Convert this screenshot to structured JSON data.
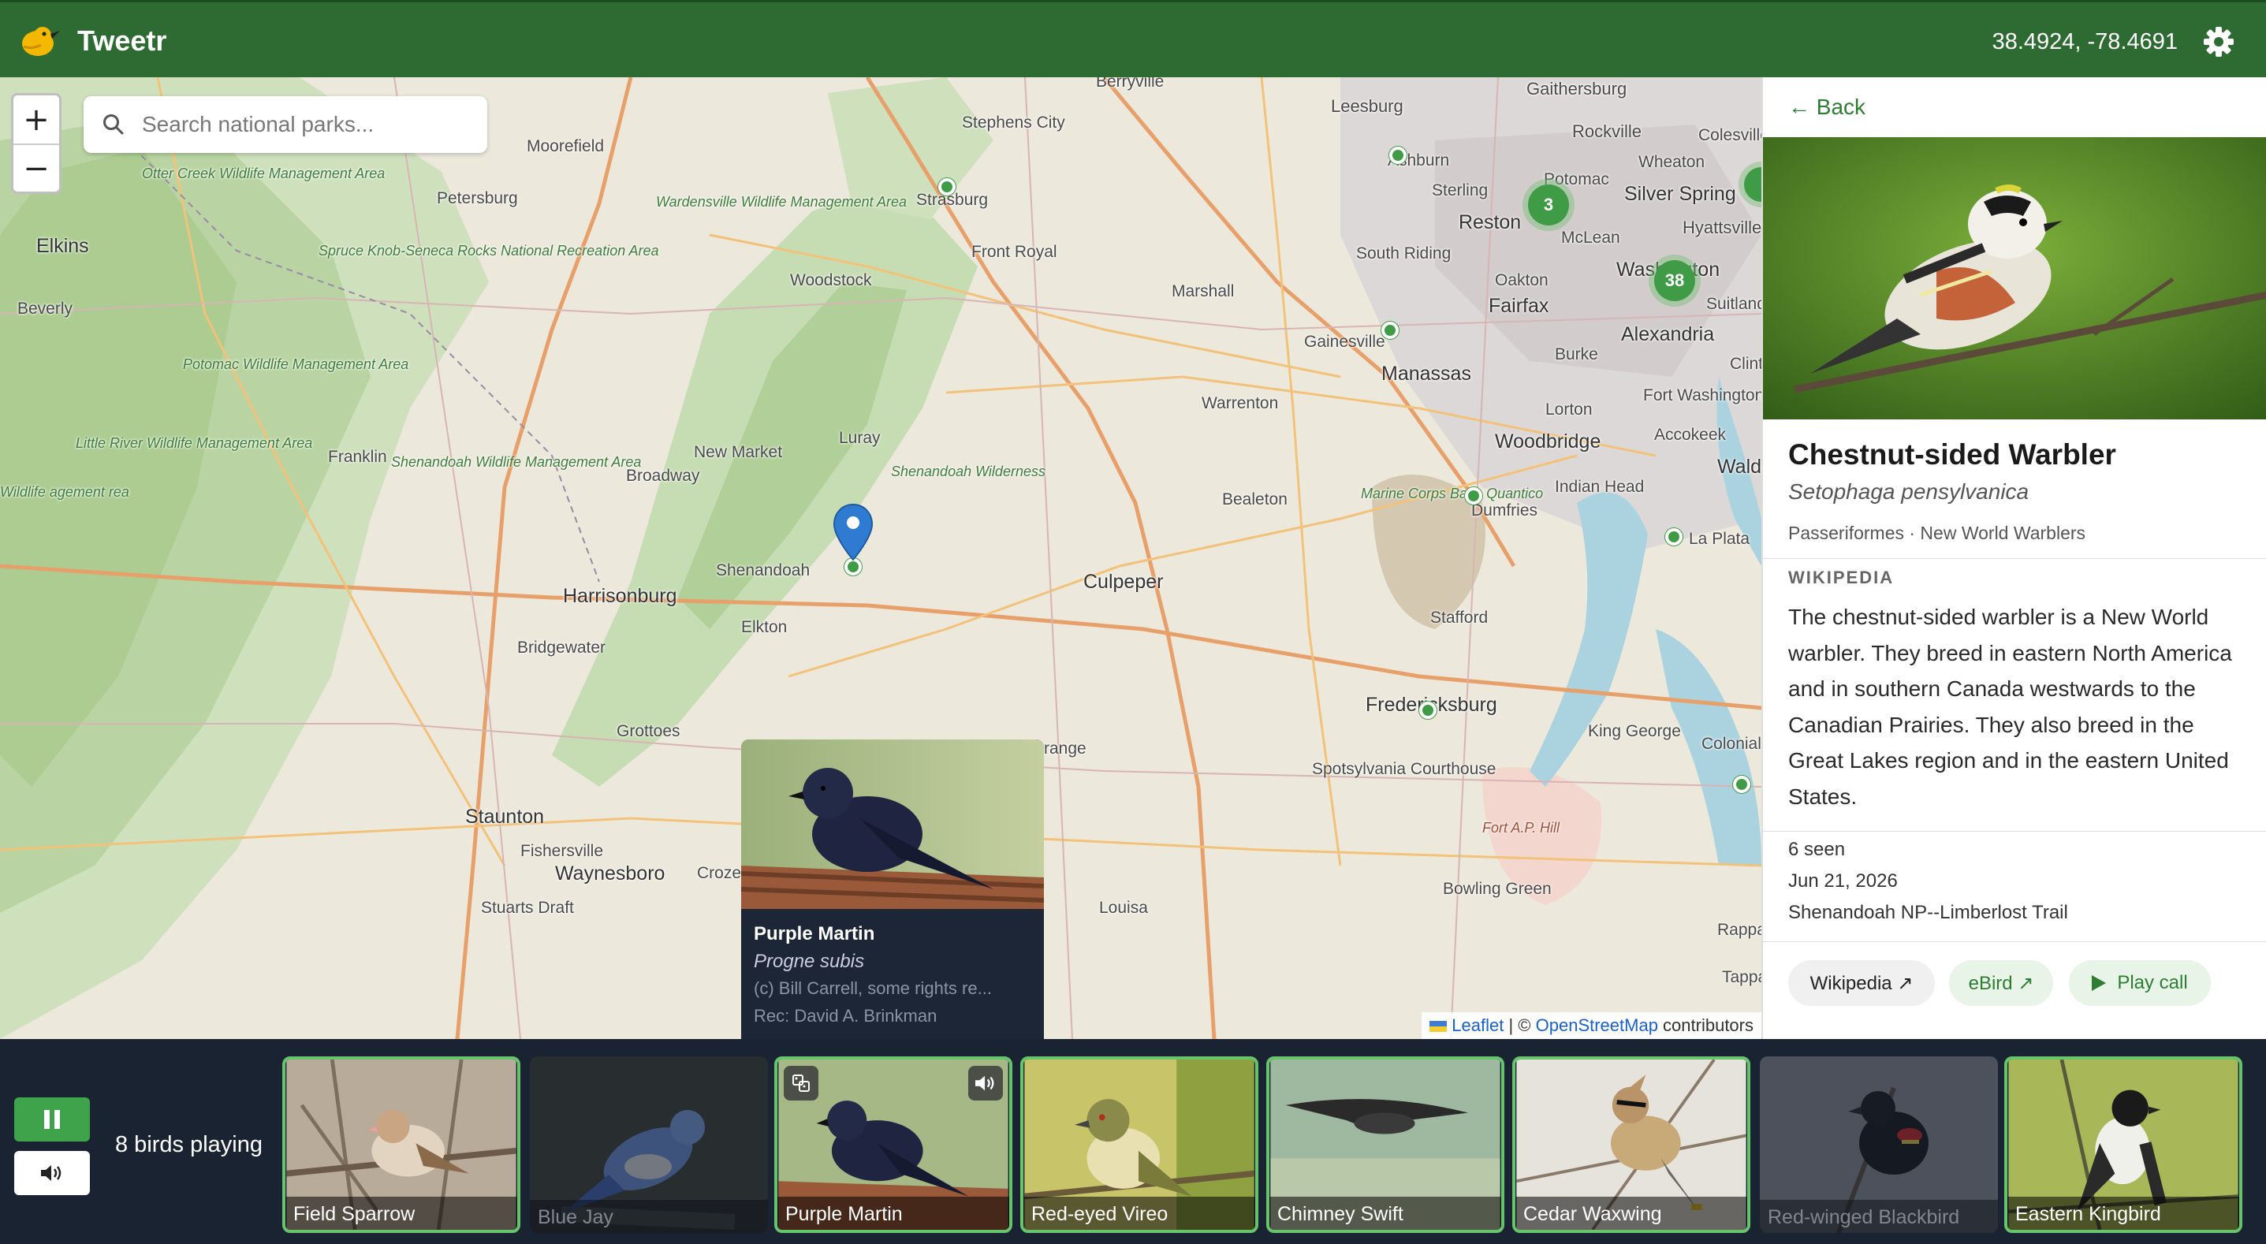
{
  "header": {
    "app_title": "Tweetr",
    "coords": "38.4924, -78.4691",
    "logo_icon": "bird-logo-icon",
    "settings_icon": "gear-icon"
  },
  "map": {
    "zoom_in": "+",
    "zoom_out": "−",
    "search_placeholder": "Search national parks...",
    "labels": {
      "berryville": "Berryville",
      "leesburg": "Leesburg",
      "gaithersburg": "Gaithersburg",
      "rockville": "Rockville",
      "colesville": "Colesville",
      "potomac": "Potomac",
      "wheaton": "Wheaton",
      "ashburn": "Ashburn",
      "stephens_city": "Stephens City",
      "moorefield": "Moorefield",
      "strasburg": "Strasburg",
      "otter_creek": "Otter Creek Wildlife Management Area",
      "petersburg": "Petersburg",
      "wardensville": "Wardensville Wildlife Management Area",
      "sterling": "Sterling",
      "silver_spring": "Silver Spring",
      "reston": "Reston",
      "mclean": "McLean",
      "hyattsville": "Hyattsville",
      "elkins": "Elkins",
      "spruce_knob": "Spruce Knob-Seneca Rocks National Recreation Area",
      "front_royal": "Front Royal",
      "south_riding": "South Riding",
      "woodstock": "Woodstock",
      "oakton": "Oakton",
      "washington": "Washington",
      "suitland": "Suitland",
      "beverly": "Beverly",
      "marshall": "Marshall",
      "fairfax": "Fairfax",
      "gainesville": "Gainesville",
      "burke": "Burke",
      "alexandria": "Alexandria",
      "clinton": "Clint",
      "potomac_wma": "Potomac Wildlife Management Area",
      "manassas": "Manassas",
      "warrenton": "Warrenton",
      "fort_washington": "Fort Washington",
      "lorton": "Lorton",
      "accokeek": "Accokeek",
      "little_river": "Little River Wildlife Management Area",
      "franklin": "Franklin",
      "shenandoah_wma": "Shenandoah Wildlife Management Area",
      "new_market": "New Market",
      "woodbridge": "Woodbridge",
      "luray": "Luray",
      "waldorf": "Waldo",
      "broadway": "Broadway",
      "shenandoah_wild": "Shenandoah Wilderness",
      "wildlife_left": "Wildlife agement rea",
      "bealeton": "Bealeton",
      "marine_corps": "Marine Corps Base Quantico",
      "dumfries": "Dumfries",
      "indian_head": "Indian Head",
      "la_plata": "La Plata",
      "shenandoah": "Shenandoah",
      "harrisonburg": "Harrisonburg",
      "culpeper": "Culpeper",
      "elkton": "Elkton",
      "stafford": "Stafford",
      "bridgewater": "Bridgewater",
      "fredericksburg": "Fredericksburg",
      "grottoes": "Grottoes",
      "king_george": "King George",
      "colonial_beach": "Colonial Beac",
      "orange": "range",
      "spotsylvania": "Spotsylvania Courthouse",
      "staunton": "Staunton",
      "fort_ap_hill": "Fort A.P. Hill",
      "fishersville": "Fishersville",
      "waynesboro": "Waynesboro",
      "crozet": "Croze",
      "stuarts_draft": "Stuarts Draft",
      "louisa": "Louisa",
      "bowling_green": "Bowling Green",
      "rappahannock": "Rappah Tappa",
      "tappahannock": "Tappa"
    },
    "clusters": {
      "c3": "3",
      "c38": "38"
    },
    "popup": {
      "name": "Purple Martin",
      "scientific": "Progne subis",
      "credit": "(c) Bill Carrell, some rights re...",
      "recordist": "Rec: David A. Brinkman"
    },
    "attribution": {
      "leaflet": "Leaflet",
      "sep": " | © ",
      "osm": "OpenStreetMap",
      "contrib": " contributors"
    }
  },
  "panel": {
    "back": "← Back",
    "name": "Chestnut-sided Warbler",
    "scientific": "Setophaga pensylvanica",
    "taxonomy": "Passeriformes · New World Warblers",
    "wiki_heading": "WIKIPEDIA",
    "wiki_text": "The chestnut-sided warbler is a New World warbler. They breed in eastern North America and in southern Canada westwards to the Canadian Prairies. They also breed in the Great Lakes region and in the eastern United States.",
    "seen": "6 seen",
    "date": "Jun 21, 2026",
    "location": "Shenandoah NP--Limberlost Trail",
    "btn_wikipedia": "Wikipedia ↗",
    "btn_ebird": "eBird ↗",
    "btn_play": "Play call"
  },
  "player": {
    "status": "8 birds playing",
    "birds": [
      {
        "name": "Field Sparrow",
        "active": true
      },
      {
        "name": "Blue Jay",
        "active": false
      },
      {
        "name": "Purple Martin",
        "active": true
      },
      {
        "name": "Red-eyed Vireo",
        "active": true
      },
      {
        "name": "Chimney Swift",
        "active": true
      },
      {
        "name": "Cedar Waxwing",
        "active": true
      },
      {
        "name": "Red-winged Blackbird",
        "active": false
      },
      {
        "name": "Eastern Kingbird",
        "active": true
      }
    ]
  },
  "colors": {
    "header": "#2e6b32",
    "accent": "#3f9b45",
    "bottom": "#1a2331"
  }
}
